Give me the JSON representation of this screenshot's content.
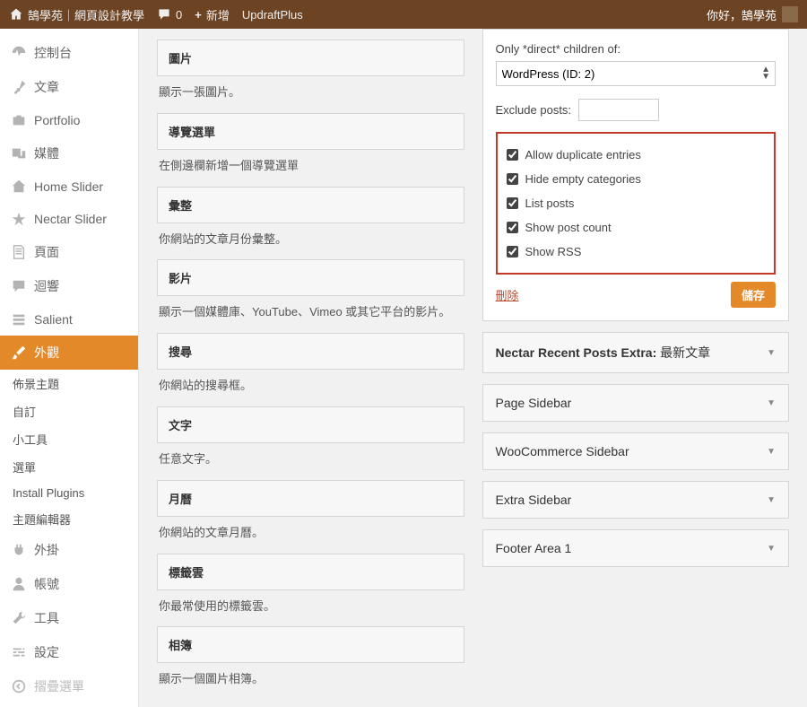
{
  "topbar": {
    "site": "鵠學苑｜網頁設計教學",
    "comments": "0",
    "add_new": "新增",
    "updraft": "UpdraftPlus",
    "greeting": "你好，鵠學苑"
  },
  "sidebar": {
    "dashboard": "控制台",
    "posts": "文章",
    "portfolio": "Portfolio",
    "media": "媒體",
    "home_slider": "Home Slider",
    "nectar_slider": "Nectar Slider",
    "pages": "頁面",
    "comments": "迴響",
    "salient": "Salient",
    "appearance": "外觀",
    "sub_theme": "佈景主題",
    "sub_customize": "自訂",
    "sub_widgets": "小工具",
    "sub_menus": "選單",
    "sub_plugins": "Install Plugins",
    "sub_editor": "主題編輯器",
    "plugins": "外掛",
    "users": "帳號",
    "tools": "工具",
    "settings": "設定",
    "collapse": "摺疊選單"
  },
  "widgets": [
    {
      "title": "圖片",
      "desc": "顯示一張圖片。"
    },
    {
      "title": "導覽選單",
      "desc": "在側邊欄新增一個導覽選單"
    },
    {
      "title": "彙整",
      "desc": "你網站的文章月份彙整。"
    },
    {
      "title": "影片",
      "desc": "顯示一個媒體庫、YouTube、Vimeo 或其它平台的影片。"
    },
    {
      "title": "搜尋",
      "desc": "你網站的搜尋框。"
    },
    {
      "title": "文字",
      "desc": "任意文字。"
    },
    {
      "title": "月曆",
      "desc": "你網站的文章月曆。"
    },
    {
      "title": "標籤雲",
      "desc": "你最常使用的標籤雲。"
    },
    {
      "title": "相簿",
      "desc": "顯示一個圖片相簿。"
    }
  ],
  "panel": {
    "children_label": "Only *direct* children of:",
    "children_value": "WordPress (ID: 2)",
    "exclude_label": "Exclude posts:",
    "exclude_value": "",
    "chk_dup": "Allow duplicate entries",
    "chk_hide": "Hide empty categories",
    "chk_list": "List posts",
    "chk_count": "Show post count",
    "chk_rss": "Show RSS",
    "delete": "刪除",
    "save": "儲存"
  },
  "sidebars": {
    "recent_prefix": "Nectar Recent Posts Extra:",
    "recent_title": " 最新文章",
    "page": "Page Sidebar",
    "woo": "WooCommerce Sidebar",
    "extra": "Extra Sidebar",
    "footer": "Footer Area 1"
  }
}
